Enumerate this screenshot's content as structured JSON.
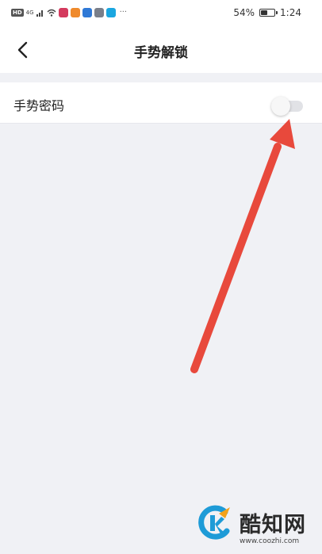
{
  "status_bar": {
    "hd": "HD",
    "signal": "4G",
    "dots": "···",
    "battery_text": "54%",
    "battery_level": 0.54,
    "time": "1:24"
  },
  "nav": {
    "title": "手势解锁",
    "back_icon": "chevron-left-icon"
  },
  "settings": {
    "gesture_password_label": "手势密码",
    "gesture_password_enabled": false
  },
  "annotation": {
    "color": "#e8493c"
  },
  "watermark": {
    "name": "酷知网",
    "url": "www.coozhi.com",
    "logo_color": "#1e9bd7",
    "logo_accent": "#f3a21b"
  }
}
